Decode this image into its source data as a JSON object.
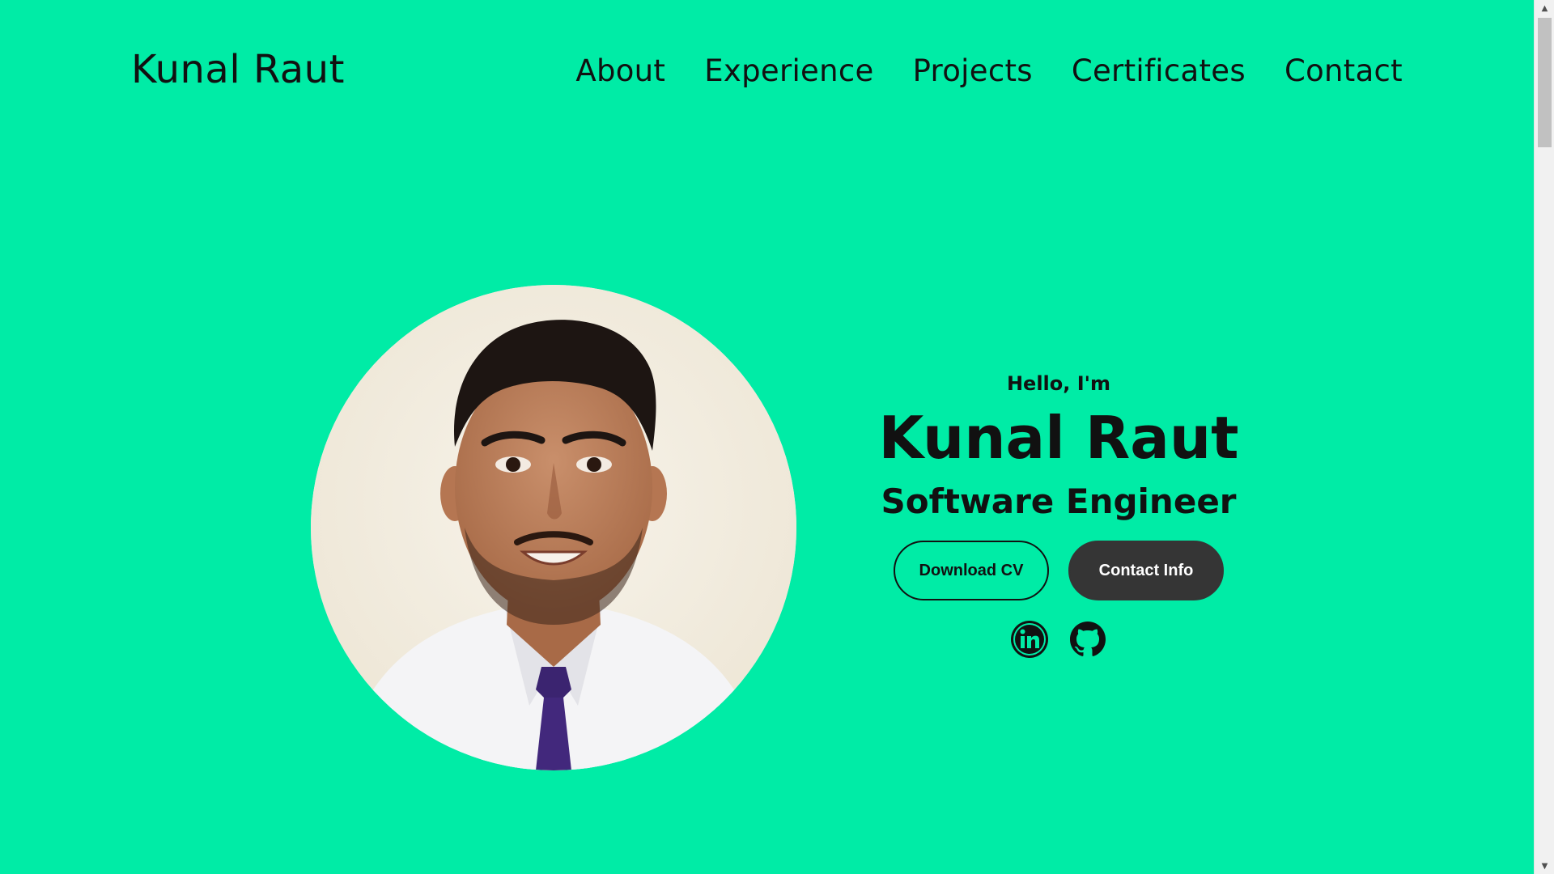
{
  "header": {
    "logo": "Kunal Raut",
    "nav": [
      {
        "label": "About"
      },
      {
        "label": "Experience"
      },
      {
        "label": "Projects"
      },
      {
        "label": "Certificates"
      },
      {
        "label": "Contact"
      }
    ]
  },
  "hero": {
    "greeting": "Hello, I'm",
    "name": "Kunal Raut",
    "role": "Software Engineer",
    "buttons": {
      "download_cv": "Download CV",
      "contact_info": "Contact Info"
    },
    "social": [
      {
        "icon": "linkedin-icon"
      },
      {
        "icon": "github-icon"
      }
    ]
  },
  "colors": {
    "background": "#00eca6",
    "text": "#111111",
    "button_dark": "#353535",
    "button_light_text": "#ffffff"
  }
}
